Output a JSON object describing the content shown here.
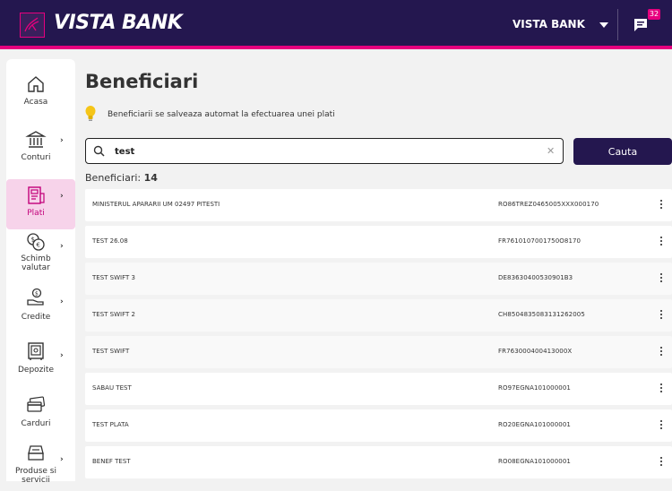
{
  "app": {
    "brand": "VISTA BANK"
  },
  "header": {
    "user_name": "VISTA BANK",
    "messages_count": "32"
  },
  "sidebar": {
    "items": [
      {
        "label": "Acasa",
        "icon": "home-icon",
        "has_arrow": false
      },
      {
        "label": "Conturi",
        "icon": "bank-icon",
        "has_arrow": true
      },
      {
        "label": "Plati",
        "icon": "payments-icon",
        "has_arrow": true,
        "active": true
      },
      {
        "label": "Schimb valutar",
        "icon": "exchange-icon",
        "has_arrow": true
      },
      {
        "label": "Credite",
        "icon": "credit-icon",
        "has_arrow": true
      },
      {
        "label": "Depozite",
        "icon": "safe-icon",
        "has_arrow": true
      },
      {
        "label": "Carduri",
        "icon": "card-icon",
        "has_arrow": false
      },
      {
        "label": "Produse si servicii",
        "icon": "products-icon",
        "has_arrow": true
      }
    ]
  },
  "main": {
    "title": "Beneficiari",
    "hint": "Beneficiarii se salveaza automat la efectuarea unei plati",
    "search": {
      "value": "test",
      "button_label": "Cauta"
    },
    "count_label": "Beneficiari:",
    "count_value": "14",
    "beneficiaries": [
      {
        "name": "MINISTERUL APARARII UM 02497 PITESTI",
        "iban": "RO86TREZ0465005XXX000170"
      },
      {
        "name": "TEST 26.08",
        "iban": "FR7610107001750O8170"
      },
      {
        "name": "TEST SWIFT 3",
        "iban": "DE83630400530901B3"
      },
      {
        "name": "TEST SWIFT 2",
        "iban": "CH8504835083131262005"
      },
      {
        "name": "TEST SWIFT",
        "iban": "FR763000400413000X"
      },
      {
        "name": "SABAU TEST",
        "iban": "RO97EGNA101000001"
      },
      {
        "name": "TEST PLATA",
        "iban": "RO20EGNA101000001"
      },
      {
        "name": "BENEF TEST",
        "iban": "RO08EGNA101000001"
      }
    ]
  },
  "colors": {
    "navy": "#24174f",
    "magenta": "#e6007e",
    "active_bg": "#f7d3ea"
  }
}
